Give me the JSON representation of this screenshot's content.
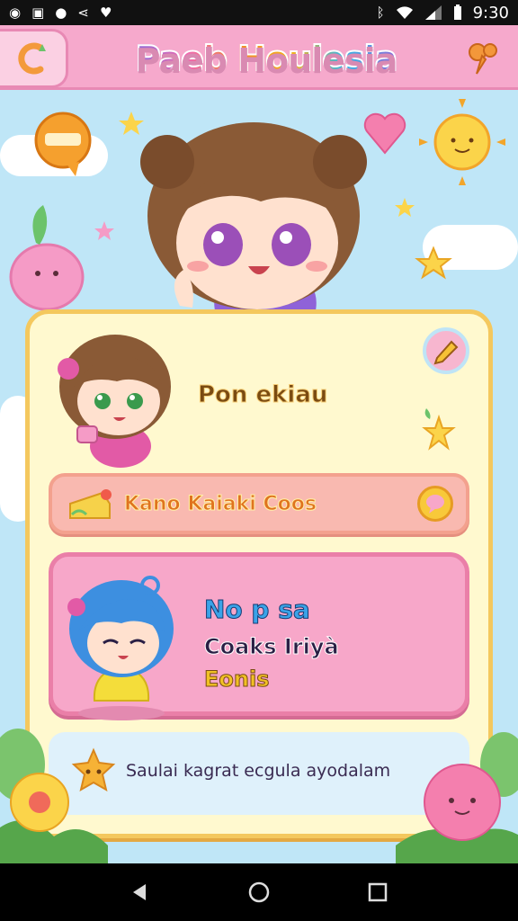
{
  "status_bar": {
    "time": "9:30",
    "icons": [
      "chrome-icon",
      "gallery-icon",
      "mail-icon",
      "share-icon",
      "bookmark-icon"
    ],
    "right_icons": [
      "bluetooth-icon",
      "wifi-icon",
      "signal-icon",
      "battery-icon"
    ]
  },
  "header": {
    "back_icon": "back-arrow-icon",
    "title": "Paeb Houlesia",
    "pin_icon": "pin-icon"
  },
  "profile": {
    "name": "Pon ekiau",
    "edit_icon": "edit-pencil-icon"
  },
  "banner": {
    "icon": "cheese-icon",
    "text": "Kano Kaiaki Coos",
    "chat_icon": "chat-bubble-icon"
  },
  "friend": {
    "line1": "No p sa",
    "line2": "Coaks Iriyà",
    "line3": "Eonis"
  },
  "footer_note": {
    "text": "Saulai kagrat ecgula ayodalam"
  },
  "nav": {
    "back": "nav-back-icon",
    "home": "nav-home-icon",
    "recents": "nav-recents-icon"
  },
  "colors": {
    "header_bg": "#f6a9cc",
    "card_bg": "#fff9cf",
    "card_border": "#f4c85e",
    "banner_bg": "#f9b9b0",
    "friend_bg": "#f7a7c9",
    "sky": "#bfe6f7"
  }
}
